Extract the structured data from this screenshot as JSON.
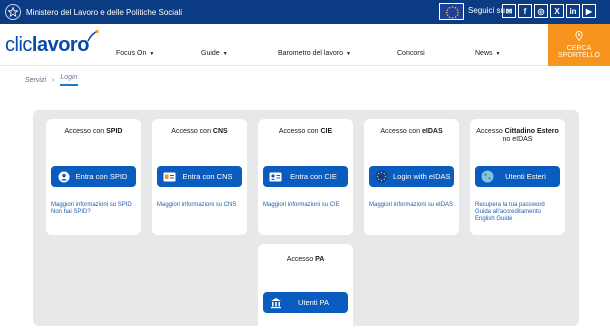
{
  "topbar": {
    "ministry": "Ministero del Lavoro e delle Politiche Sociali",
    "follow_label": "Seguici su",
    "social": [
      {
        "icon": "mail-icon",
        "glyph": "✉"
      },
      {
        "icon": "facebook-icon",
        "glyph": "f"
      },
      {
        "icon": "instagram-icon",
        "glyph": "◎"
      },
      {
        "icon": "x-icon",
        "glyph": "X"
      },
      {
        "icon": "linkedin-icon",
        "glyph": "in"
      },
      {
        "icon": "youtube-icon",
        "glyph": "▶"
      }
    ]
  },
  "nav": {
    "logo_part1": "clic",
    "logo_part2": "lavoro",
    "items": [
      {
        "label": "Focus On",
        "dropdown": true
      },
      {
        "label": "Guide",
        "dropdown": true
      },
      {
        "label": "Barometro del lavoro",
        "dropdown": true
      },
      {
        "label": "Concorsi",
        "dropdown": false
      },
      {
        "label": "News",
        "dropdown": true
      }
    ],
    "cta": "CERCA SPORTELLO"
  },
  "breadcrumb": {
    "items": [
      "Servizi",
      "Login"
    ]
  },
  "cards": [
    {
      "title_prefix": "Accesso con ",
      "title_bold": "SPID",
      "button": "Entra con SPID",
      "icon": "spid-user-icon",
      "links": [
        "Maggiori informazioni su SPID",
        "Non hai SPID?"
      ]
    },
    {
      "title_prefix": "Accesso con ",
      "title_bold": "CNS",
      "button": "Entra con CNS",
      "icon": "id-card-icon",
      "links": [
        "Maggiori informazioni su CNS"
      ]
    },
    {
      "title_prefix": "Accesso con ",
      "title_bold": "CIE",
      "button": "Entra con CIE",
      "icon": "cie-card-icon",
      "links": [
        "Maggiori informazioni su CIE"
      ]
    },
    {
      "title_prefix": "Accesso con ",
      "title_bold": "eIDAS",
      "button": "Login with eIDAS",
      "icon": "eidas-stars-icon",
      "links": [
        "Maggiori informazioni su eIDAS"
      ]
    },
    {
      "title_prefix": "Accesso ",
      "title_bold": "Cittadino Estero",
      "title_suffix": "no eIDAS",
      "button": "Utenti Esteri",
      "icon": "globe-icon",
      "links": [
        "Recupera la tua password",
        "Guida all'accreditamento",
        "English Guide"
      ]
    },
    {
      "title_prefix": "Accesso ",
      "title_bold": "PA",
      "button": "Utenti PA",
      "icon": "building-icon",
      "links": []
    }
  ],
  "colors": {
    "topbar": "#0b3b82",
    "brand": "#0a4aa8",
    "button": "#0a5cbf",
    "cta": "#f7941d",
    "panel": "#e7e8ea"
  }
}
